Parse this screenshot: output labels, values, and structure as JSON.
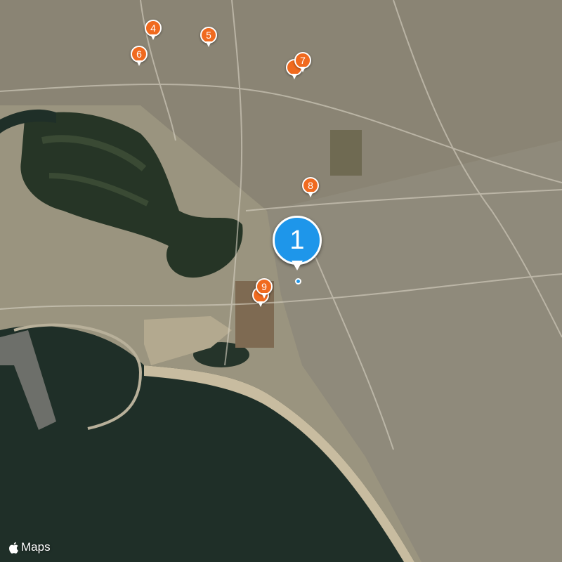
{
  "map": {
    "view": "satellite",
    "colors": {
      "sea": "#1f2f28",
      "land": "#a89e86",
      "urban": "#8e897a",
      "vegetation": "#3a4a34",
      "beach": "#c8bca0",
      "road": "#d9d3c4"
    }
  },
  "markers": [
    {
      "label": "1",
      "color": "#1e96ea",
      "type": "selected-pin"
    },
    {
      "label": "4",
      "color": "#f06a1f"
    },
    {
      "label": "5",
      "color": "#f06a1f"
    },
    {
      "label": "6",
      "color": "#f06a1f"
    },
    {
      "label": "7",
      "color": "#f06a1f"
    },
    {
      "label": "8",
      "color": "#f06a1f"
    },
    {
      "label": "9",
      "color": "#f06a1f"
    }
  ],
  "attribution": {
    "brand": "Maps",
    "icon": "apple-logo-icon"
  }
}
